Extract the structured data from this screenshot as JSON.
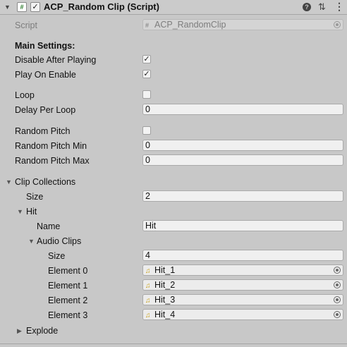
{
  "header": {
    "fold_glyph": "▼",
    "script_icon_glyph": "#",
    "enabled_glyph": "✓",
    "title": "ACP_Random Clip (Script)",
    "help_glyph": "?",
    "presets_glyph": "⇅",
    "menu_glyph": "⋮"
  },
  "glyphs": {
    "check": "✓",
    "expanded": "▼",
    "collapsed": "▶",
    "script": "#",
    "audio": "♫"
  },
  "script": {
    "label": "Script",
    "value": "ACP_RandomClip"
  },
  "main_settings": {
    "heading": "Main Settings:",
    "disable_after_playing": {
      "label": "Disable After Playing",
      "checked": true
    },
    "play_on_enable": {
      "label": "Play On Enable",
      "checked": true
    }
  },
  "loop": {
    "label": "Loop",
    "checked": false
  },
  "delay_per_loop": {
    "label": "Delay Per Loop",
    "value": "0"
  },
  "random_pitch": {
    "label": "Random Pitch",
    "checked": false
  },
  "random_pitch_min": {
    "label": "Random Pitch Min",
    "value": "0"
  },
  "random_pitch_max": {
    "label": "Random Pitch Max",
    "value": "0"
  },
  "clip_collections": {
    "label": "Clip Collections",
    "size_label": "Size",
    "size_value": "2",
    "hit": {
      "label": "Hit",
      "name_label": "Name",
      "name_value": "Hit",
      "audio_clips": {
        "label": "Audio Clips",
        "size_label": "Size",
        "size_value": "4",
        "elements": [
          {
            "label": "Element 0",
            "value": "Hit_1"
          },
          {
            "label": "Element 1",
            "value": "Hit_2"
          },
          {
            "label": "Element 2",
            "value": "Hit_3"
          },
          {
            "label": "Element 3",
            "value": "Hit_4"
          }
        ]
      }
    },
    "explode": {
      "label": "Explode"
    }
  }
}
